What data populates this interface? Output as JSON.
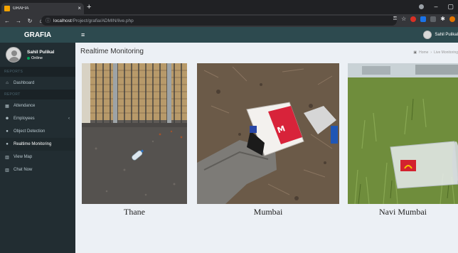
{
  "browser": {
    "tab_title": "GRAFIA",
    "url_host": "localhost",
    "url_path": "/Project/grafia/ADMIN/live.php"
  },
  "sidebar": {
    "brand": "GRAFIA",
    "user": {
      "name": "Sahil Pulikal",
      "status": "Online"
    },
    "sections": [
      "REPORTS",
      "REPORT"
    ],
    "items": [
      {
        "label": "Dashboard",
        "icon": "home-icon"
      },
      {
        "label": "Attendance",
        "icon": "calendar-icon"
      },
      {
        "label": "Employees",
        "icon": "users-icon"
      },
      {
        "label": "Object Detection",
        "icon": "map-marker-icon"
      },
      {
        "label": "Realtime Monitoring",
        "icon": "map-marker-icon"
      },
      {
        "label": "View Map",
        "icon": "chart-icon"
      },
      {
        "label": "Chat Now",
        "icon": "chart-icon"
      }
    ]
  },
  "navbar": {
    "user_name": "Sahil Pulikal"
  },
  "main": {
    "title": "Realtime Monitoring",
    "breadcrumb": {
      "home": "Home",
      "current": "Live Monitoring"
    },
    "cards": [
      {
        "caption": "Thane"
      },
      {
        "caption": "Mumbai"
      },
      {
        "caption": "Navi Mumbai"
      }
    ]
  },
  "colors": {
    "navbar": "#2d4a4f",
    "sidebar": "#222d32",
    "content_bg": "#ecf0f5"
  }
}
